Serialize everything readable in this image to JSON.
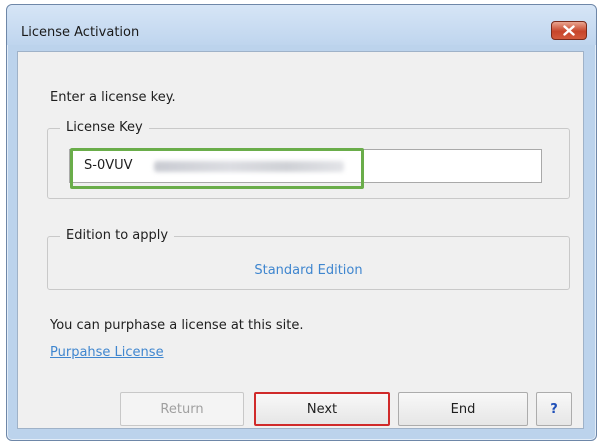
{
  "window": {
    "title": "License Activation"
  },
  "dialog": {
    "prompt": "Enter a license key.",
    "license_group": {
      "legend": "License Key",
      "key_value": "S-0VUV"
    },
    "edition_group": {
      "legend": "Edition to apply",
      "edition_value": "Standard Edition"
    },
    "purchase_text": "You can purphase a license at this site.",
    "purchase_link": "Purpahse License"
  },
  "buttons": {
    "return_label": "Return",
    "next_label": "Next",
    "end_label": "End",
    "help_label": "?"
  },
  "icons": {
    "close": "close-icon"
  },
  "colors": {
    "link": "#3f86cf",
    "highlight_green": "#6aad4a",
    "focus_red": "#d02a2a",
    "close_red": "#c7452a"
  }
}
